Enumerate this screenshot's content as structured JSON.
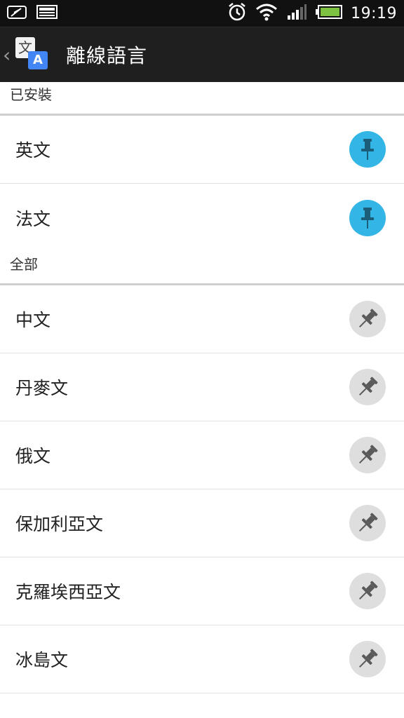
{
  "status_bar": {
    "time": "19:19",
    "icons": [
      "feather-icon",
      "image-icon",
      "alarm-icon",
      "wifi-icon",
      "signal-icon",
      "battery-icon"
    ]
  },
  "app_bar": {
    "title": "離線語言",
    "app_icon_glyphs": [
      "文",
      "A"
    ]
  },
  "sections": {
    "installed": {
      "header": "已安裝",
      "items": [
        {
          "label": "英文"
        },
        {
          "label": "法文"
        }
      ]
    },
    "all": {
      "header": "全部",
      "items": [
        {
          "label": "中文"
        },
        {
          "label": "丹麥文"
        },
        {
          "label": "俄文"
        },
        {
          "label": "保加利亞文"
        },
        {
          "label": "克羅埃西亞文"
        },
        {
          "label": "冰島文"
        }
      ]
    }
  },
  "colors": {
    "installed_pin_bg": "#33b5e5",
    "available_pin_bg": "#dedede",
    "app_bar_bg": "#1f1f1f"
  }
}
